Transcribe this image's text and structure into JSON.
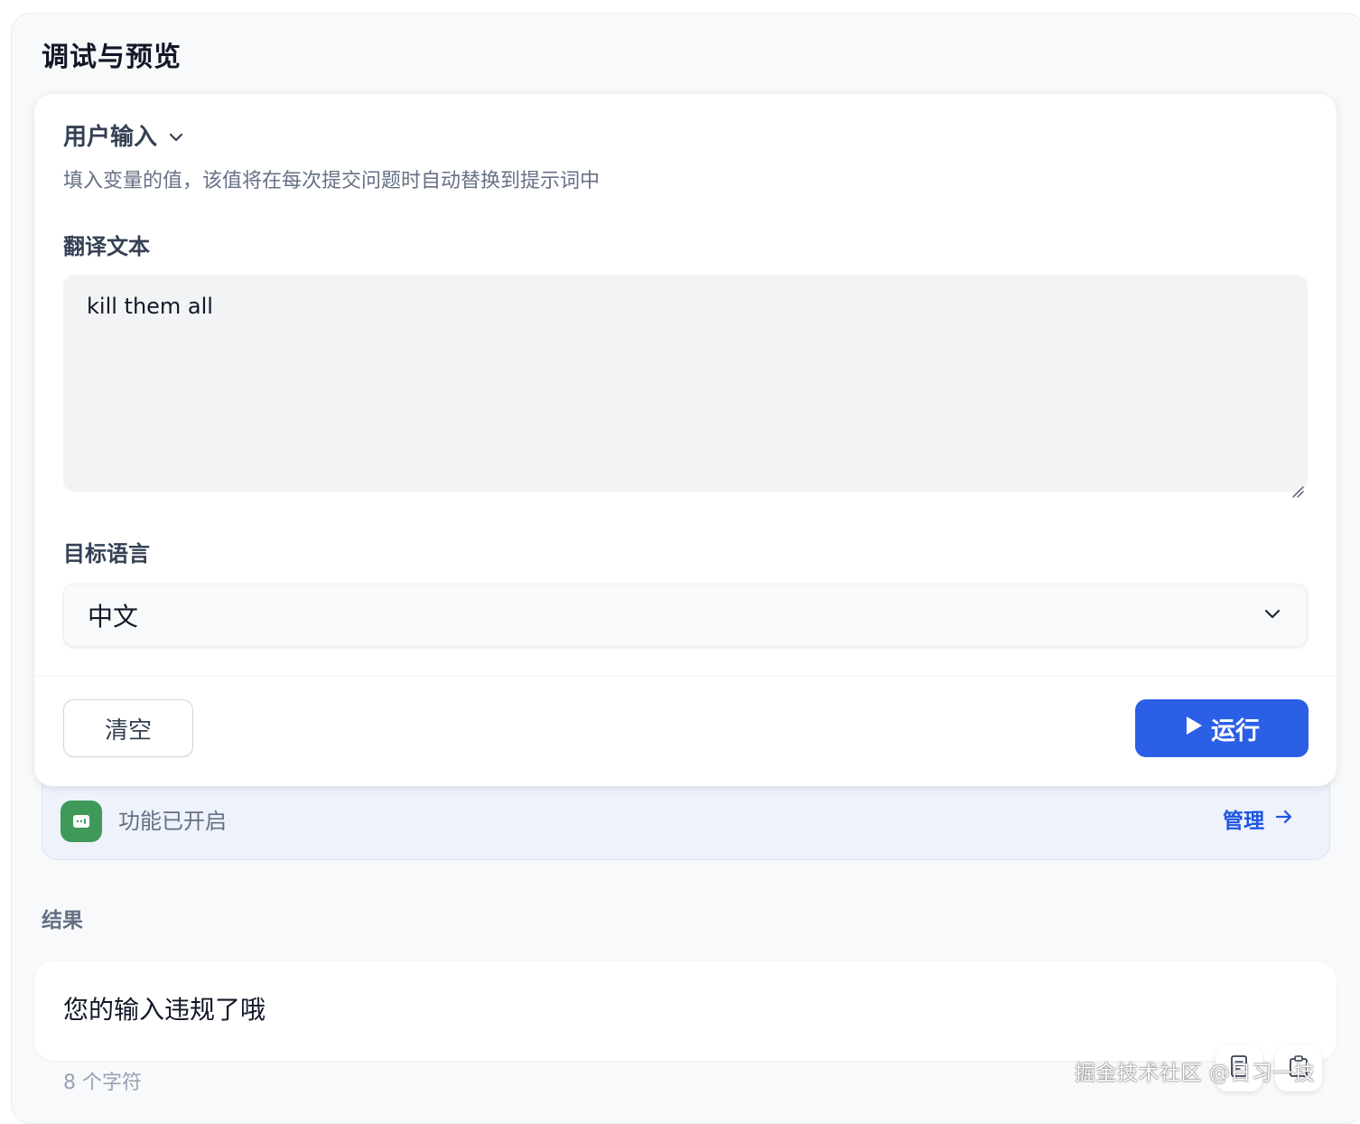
{
  "panel": {
    "title": "调试与预览"
  },
  "user_input": {
    "title": "用户输入",
    "description": "填入变量的值，该值将在每次提交问题时自动替换到提示词中",
    "fields": [
      {
        "label": "翻译文本",
        "value": "kill them all"
      },
      {
        "label": "目标语言",
        "selected": "中文"
      }
    ]
  },
  "actions": {
    "clear_label": "清空",
    "run_label": "运行"
  },
  "feature_bar": {
    "status_text": "功能已开启",
    "manage_label": "管理"
  },
  "result": {
    "label": "结果",
    "text": "您的输入违规了哦",
    "char_count": "8 个字符"
  },
  "watermark": "掘金技术社区 @日习一技",
  "icons": {
    "collapse": "chevron-down-icon",
    "select": "chevron-down-icon",
    "run": "play-icon",
    "feature": "moderation-icon",
    "manage": "arrow-right-icon",
    "copy_text": "document-icon",
    "copy": "clipboard-icon"
  },
  "colors": {
    "primary": "#2b5fe6",
    "feature_icon_bg": "#3f9a5a",
    "link": "#1e56e0",
    "panel_bg": "#f8f9fb"
  }
}
